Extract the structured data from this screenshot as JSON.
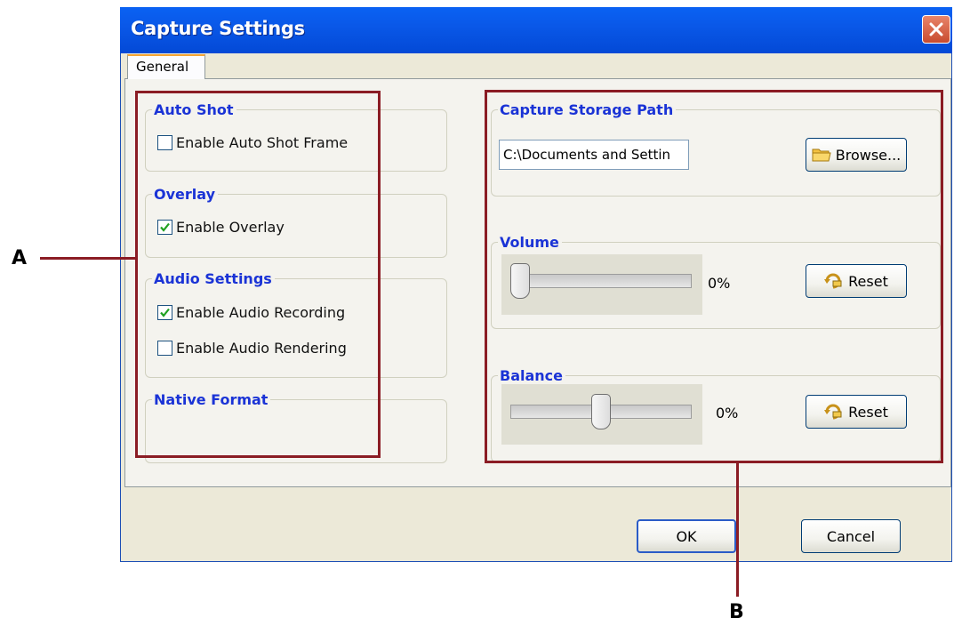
{
  "window": {
    "title": "Capture Settings"
  },
  "tabs": [
    {
      "label": "General",
      "selected": true
    }
  ],
  "auto_shot": {
    "title": "Auto Shot",
    "enable_frame": {
      "label": "Enable Auto Shot Frame",
      "checked": false
    }
  },
  "overlay": {
    "title": "Overlay",
    "enable_overlay": {
      "label": "Enable Overlay",
      "checked": true
    }
  },
  "audio": {
    "title": "Audio Settings",
    "enable_recording": {
      "label": "Enable Audio Recording",
      "checked": true
    },
    "enable_rendering": {
      "label": "Enable Audio Rendering",
      "checked": false
    }
  },
  "native_format": {
    "title": "Native Format"
  },
  "storage": {
    "title": "Capture Storage Path",
    "path_value": "C:\\Documents and Settin",
    "browse_label": "Browse..."
  },
  "volume": {
    "title": "Volume",
    "value_text": "0%",
    "level": 0.0,
    "reset_label": "Reset"
  },
  "balance": {
    "title": "Balance",
    "value_text": "0%",
    "level": 0.5,
    "reset_label": "Reset"
  },
  "footer": {
    "ok_label": "OK",
    "cancel_label": "Cancel"
  },
  "annotations": {
    "left_letter": "A",
    "bottom_letter": "B"
  },
  "colors": {
    "title_bar": "#0a58e8",
    "group_title": "#1a33d6",
    "annotation_box": "#8b1c24"
  }
}
